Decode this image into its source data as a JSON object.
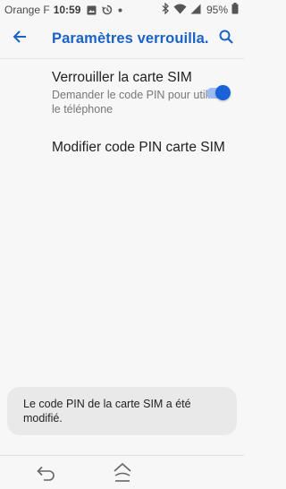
{
  "status_bar": {
    "carrier": "Orange F",
    "time": "10:59",
    "battery": "95%"
  },
  "app_bar": {
    "title": "Paramètres verrouilla..."
  },
  "settings": {
    "lock_sim": {
      "title": "Verrouiller la carte SIM",
      "summary": "Demander le code PIN pour utiliser le téléphone",
      "enabled": true
    },
    "change_pin": {
      "title": "Modifier code PIN carte SIM"
    }
  },
  "toast": {
    "message": "Le code PIN de la carte SIM a été modifié."
  },
  "colors": {
    "accent": "#1a62c6",
    "toggle_track": "#9dbcf0",
    "toggle_thumb": "#1a62d8"
  }
}
